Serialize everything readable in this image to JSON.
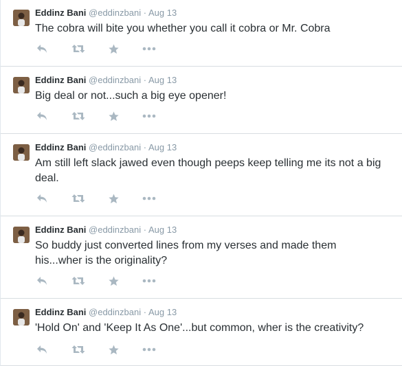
{
  "tweets": [
    {
      "name": "Eddinz Bani",
      "handle": "@eddinzbani",
      "separator": "·",
      "time": "Aug 13",
      "text": "The cobra will bite you whether you call it cobra or Mr. Cobra"
    },
    {
      "name": "Eddinz Bani",
      "handle": "@eddinzbani",
      "separator": "·",
      "time": "Aug 13",
      "text": "Big deal or not...such a big eye opener!"
    },
    {
      "name": "Eddinz Bani",
      "handle": "@eddinzbani",
      "separator": "·",
      "time": "Aug 13",
      "text": "Am still left slack jawed even though peeps keep telling me its not a big deal."
    },
    {
      "name": "Eddinz Bani",
      "handle": "@eddinzbani",
      "separator": "·",
      "time": "Aug 13",
      "text": "So buddy just converted lines from my verses and made them his...wher is the originality?"
    },
    {
      "name": "Eddinz Bani",
      "handle": "@eddinzbani",
      "separator": "·",
      "time": "Aug 13",
      "text": "'Hold On' and 'Keep It As One'...but common, wher is the creativity?"
    }
  ],
  "actions": [
    {
      "icon": "reply-icon"
    },
    {
      "icon": "retweet-icon"
    },
    {
      "icon": "favorite-star-icon"
    },
    {
      "icon": "more-options-icon"
    }
  ],
  "colors": {
    "name": "#292f33",
    "meta": "#8899a6",
    "icon": "#aab8c2",
    "divider": "#d8dde1"
  }
}
